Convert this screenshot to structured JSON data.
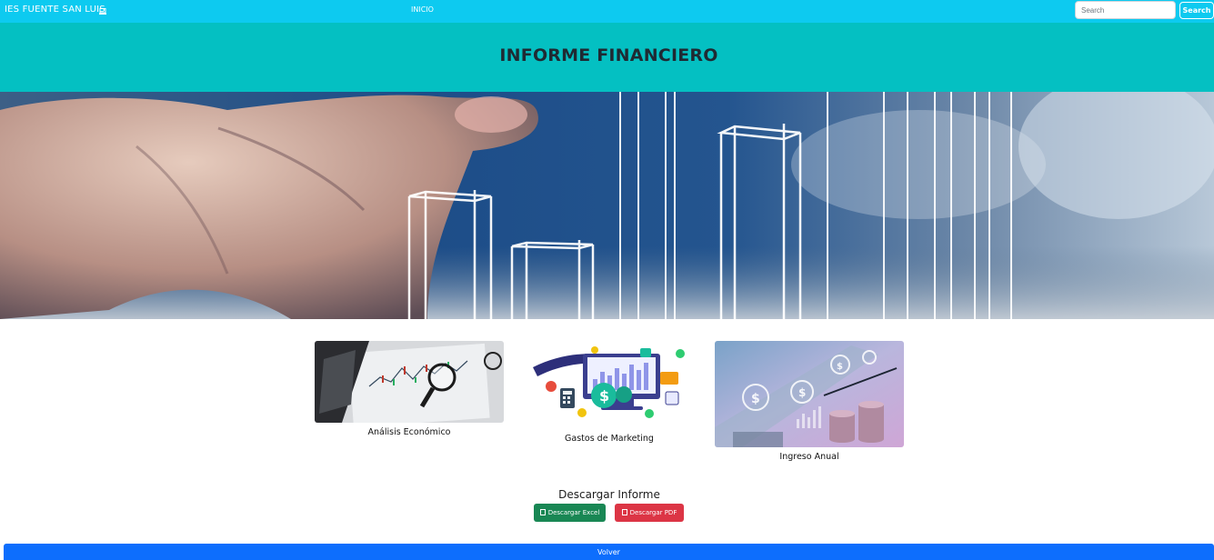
{
  "navbar": {
    "brand": "IES FUENTE SAN LUIS",
    "brand_icon": "laptop-icon",
    "link_inicio": "INICIO",
    "search_placeholder": "Search",
    "search_button": "Search",
    "color": "#0dcaf0"
  },
  "header": {
    "title": "INFORME FINANCIERO",
    "color": "#04c0c2"
  },
  "cards": [
    {
      "label": "Análisis Económico"
    },
    {
      "label": "Gastos de Marketing"
    },
    {
      "label": "Ingreso Anual"
    }
  ],
  "download": {
    "title": "Descargar Informe",
    "excel_label": "Descargar Excel",
    "pdf_label": "Descargar PDF",
    "excel_color": "#198754",
    "pdf_color": "#dc3545",
    "icon": "file-icon"
  },
  "footer": {
    "back_label": "Volver",
    "color": "#0d6efd"
  }
}
